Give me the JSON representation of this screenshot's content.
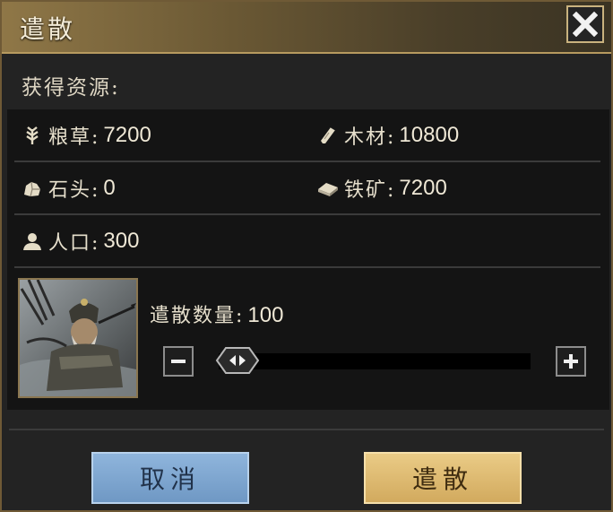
{
  "dialog": {
    "title": "遣散",
    "close_icon": "close-icon"
  },
  "resources": {
    "header": "获得资源:",
    "items": [
      {
        "icon": "wheat-icon",
        "label": "粮草:",
        "value": "7200"
      },
      {
        "icon": "wood-icon",
        "label": "木材:",
        "value": "10800"
      },
      {
        "icon": "stone-icon",
        "label": "石头:",
        "value": "0"
      },
      {
        "icon": "iron-icon",
        "label": "铁矿:",
        "value": "7200"
      },
      {
        "icon": "population-icon",
        "label": "人口:",
        "value": "300"
      }
    ]
  },
  "dismiss": {
    "quantity_label": "遣散数量:",
    "quantity_value": "100",
    "slider_fraction": 0.0
  },
  "buttons": {
    "cancel": "取消",
    "confirm": "遣散"
  },
  "colors": {
    "cancel_button": "#7ea7d2",
    "confirm_button": "#ddb86c",
    "title_bar": "#7a6640"
  }
}
